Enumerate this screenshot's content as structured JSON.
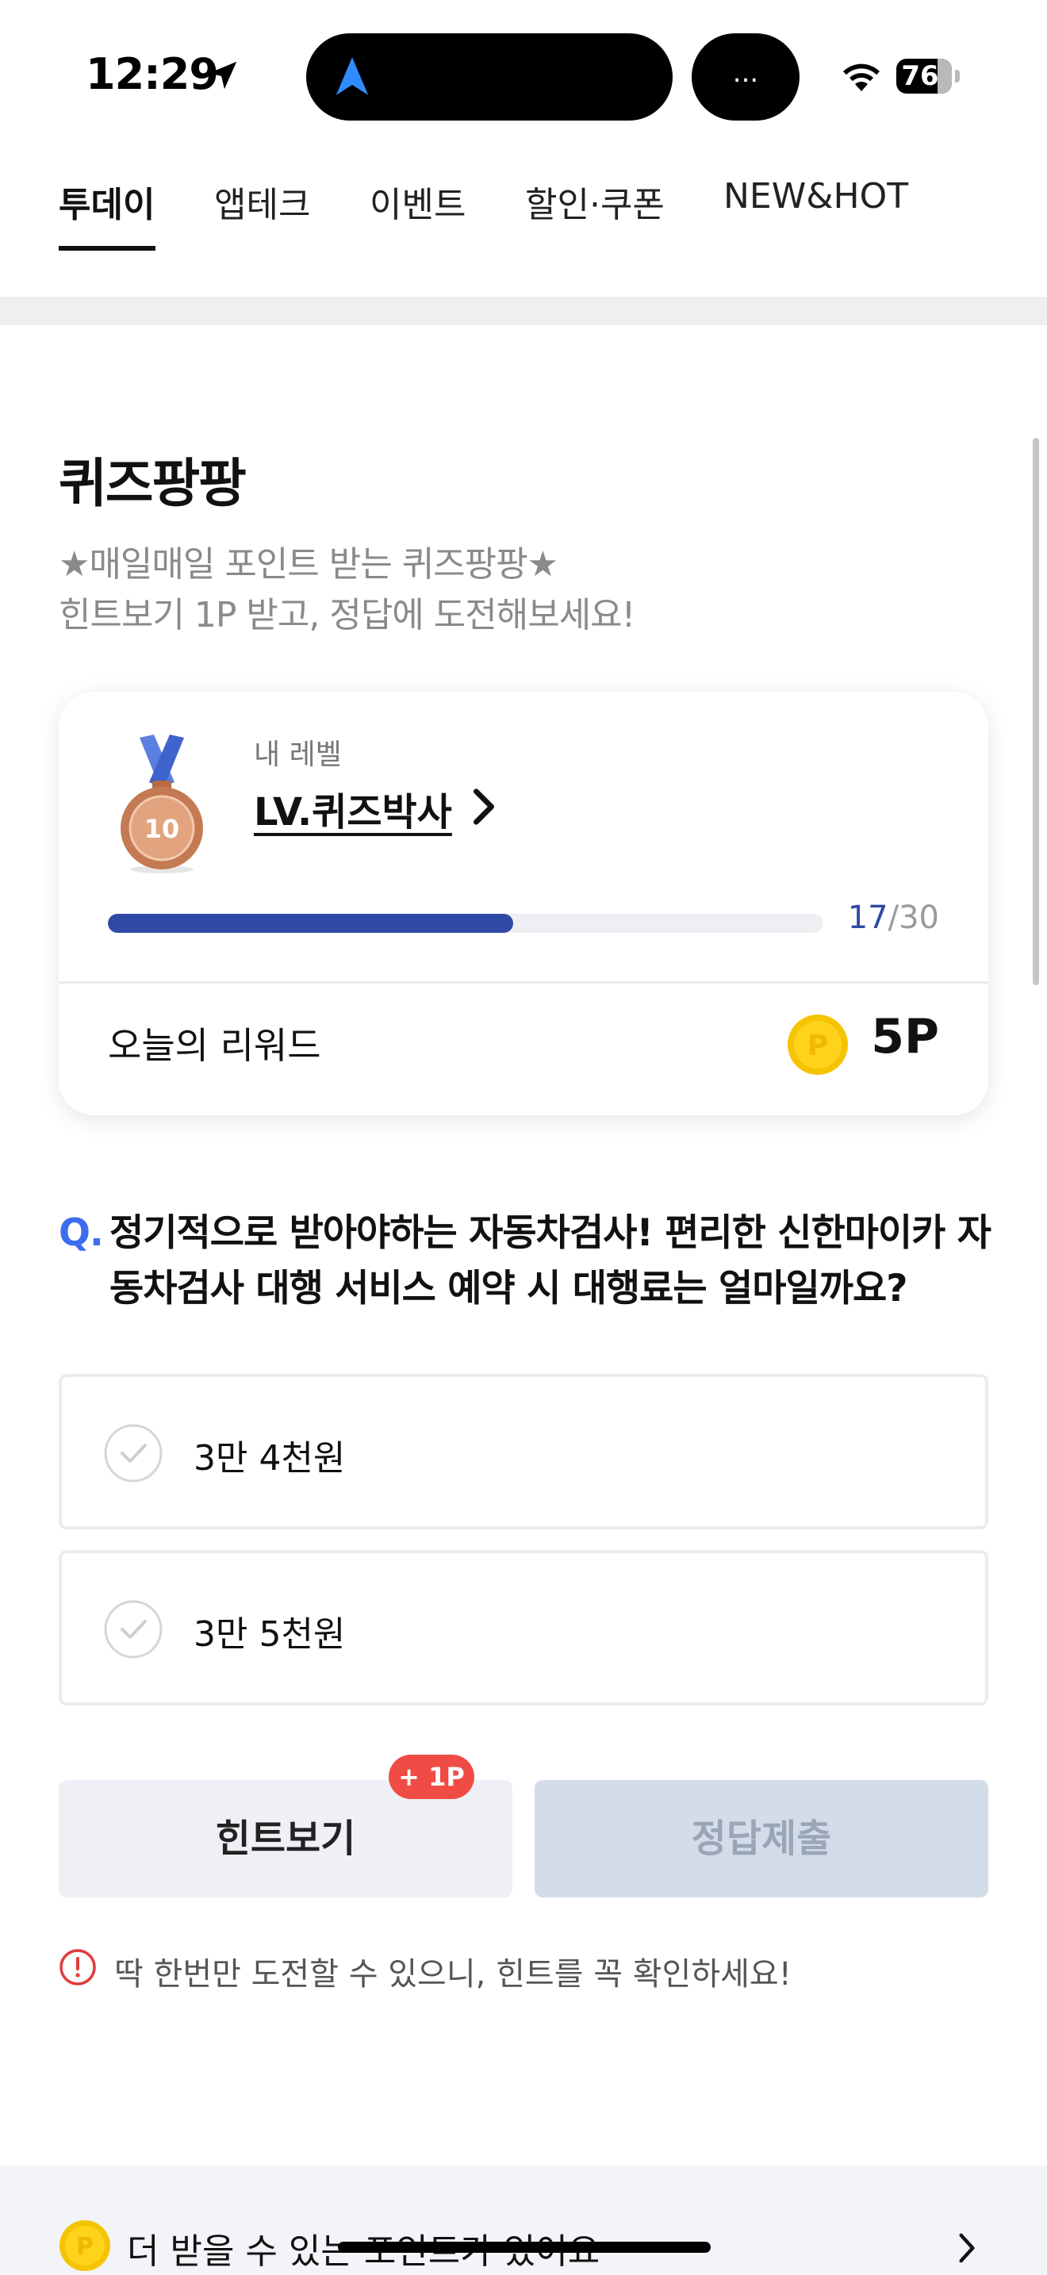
{
  "status_bar": {
    "time": "12:29",
    "battery": "76",
    "island_dots": "..."
  },
  "tabs": [
    {
      "label": "투데이",
      "active": true
    },
    {
      "label": "앱테크",
      "active": false
    },
    {
      "label": "이벤트",
      "active": false
    },
    {
      "label": "할인·쿠폰",
      "active": false
    },
    {
      "label": "NEW&HOT",
      "active": false
    }
  ],
  "quiz": {
    "title": "퀴즈팡팡",
    "desc_line1": "★매일매일 포인트 받는 퀴즈팡팡★",
    "desc_line2": "힌트보기 1P 받고, 정답에 도전해보세요!"
  },
  "level_card": {
    "medal_number": "10",
    "label": "내 레벨",
    "name": "LV.퀴즈박사",
    "progress_current": "17",
    "progress_total": "/30",
    "progress_fraction": 0.567,
    "reward_label": "오늘의 리워드",
    "coin_letter": "P",
    "reward_value": "5P"
  },
  "question": {
    "mark": "Q.",
    "text": "정기적으로 받아야하는 자동차검사! 편리한 신한마이카 자동차검사 대행 서비스 예약 시 대행료는 얼마일까요?"
  },
  "answers": [
    {
      "label": "3만 4천원"
    },
    {
      "label": "3만 5천원"
    }
  ],
  "buttons": {
    "hint": "힌트보기",
    "hint_badge": "+ 1P",
    "submit": "정답제출"
  },
  "notice": "딱 한번만 도전할 수 있으니, 힌트를 꼭 확인하세요!",
  "bottom_banner": {
    "coin_letter": "P",
    "text": "더 받을 수 있는 포인트가 있어요"
  },
  "colors": {
    "accent": "#2f49a6",
    "question_mark": "#3d6cf0",
    "badge": "#f04c45",
    "coin": "#f5c400"
  }
}
